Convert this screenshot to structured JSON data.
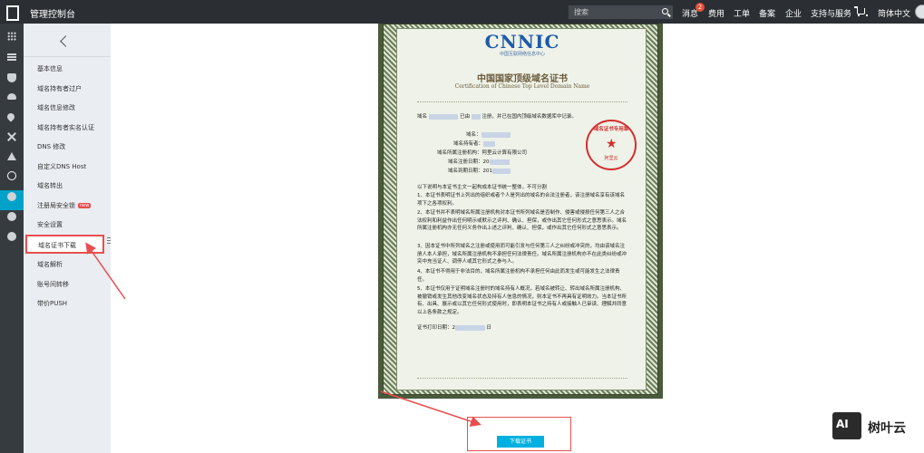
{
  "topbar": {
    "console_title": "管理控制台",
    "search_placeholder": "搜索",
    "nav": {
      "messages": "消息",
      "messages_badge": "2",
      "billing": "费用",
      "tickets": "工单",
      "filing": "备案",
      "enterprise": "企业",
      "support": "支持与服务",
      "language": "简体中文"
    }
  },
  "sidebar": {
    "items": [
      {
        "label": "基本信息"
      },
      {
        "label": "域名持有者过户"
      },
      {
        "label": "域名信息修改"
      },
      {
        "label": "域名持有者实名认证"
      },
      {
        "label": "DNS 修改"
      },
      {
        "label": "自定义DNS Host"
      },
      {
        "label": "域名转出"
      },
      {
        "label": "注册局安全锁",
        "badge": "new"
      },
      {
        "label": "安全设置"
      },
      {
        "label": "域名证书下载"
      },
      {
        "label": "域名解析"
      },
      {
        "label": "账号间转移"
      },
      {
        "label": "带价PUSH"
      }
    ]
  },
  "certificate": {
    "logo": "CNNIC",
    "logo_sub": "中国互联网络信息中心",
    "title": "中国国家顶级域名证书",
    "subtitle": "Certification of Chinese Top Level Domain Name",
    "intro_prefix": "域名",
    "intro_mid": "已由",
    "intro_suffix": "注册，并已在国内顶级域名数据库中记录。",
    "fields": {
      "domain_label": "域名：",
      "holder_label": "域名持有者：",
      "registrar_label": "域名所属注册机构：",
      "registrar_value": "阿里云计算有限公司",
      "reg_date_label": "域名注册日期：",
      "expire_date_label": "域名到期日期：",
      "reg_date_value": "20",
      "expire_date_value": "201"
    },
    "notes_intro": "以下说明与本证书主文一起构成本证书统一整体，不可分割",
    "notes": [
      "1、本证书表明证书上列出的组织或者个人是列出的域名的合法注册者，该注册域名享有该域名项下之各项权利。",
      "2、本证书并不表明域名所属注册机构对本证书所列域名是否制作、侵害或侵损任何第三人之合法权利和利益作出任何明示或默示之评判、确认、担保，或作出其它任何形式之意思表示。域名所属注册机构亦无任何义务作出上述之评判、确认、担保，或作出其它任何形式之意思表示。",
      "3、因本证书中所列域名之注册或使用而可能引发与任何第三人之纠纷或冲突的，均由该域名注册人本人承担，域名所属注册机构不承担任何法律责任。域名所属注册机构亦不在此类纠纷或冲突中充当证人、调停人或其它形式之参与人。",
      "4、本证书不得用于非法目的，域名所属注册机构不承担任何由此而发生或可能发生之法律责任。",
      "5、本证书仅用于证明域名注册时的域名持有人概况，若域名被转让、转出域名所属注册机构、被撤销或发生其他改变域名状态及持有人信息的情况，则本证书不再具有证明效力。当本证书所有、出具、展示或以其它任何形式使用时，即表明本证书之持有人或接触人已审读、理解并同意以上各条款之规定。"
    ],
    "print_date_label": "证书打印日期：",
    "print_date_value": "2",
    "print_date_suffix": "日",
    "seal_text": "域名证书专用章",
    "seal_brand": "阿里云"
  },
  "download": {
    "button_label": "下载证书"
  },
  "watermark": {
    "logo_text": "AI",
    "text": "树叶云"
  },
  "colors": {
    "topbar": "#2b2f33",
    "accent": "#00a2ca",
    "annotation_red": "#e94e4e",
    "seal_red": "#d32f2f"
  }
}
